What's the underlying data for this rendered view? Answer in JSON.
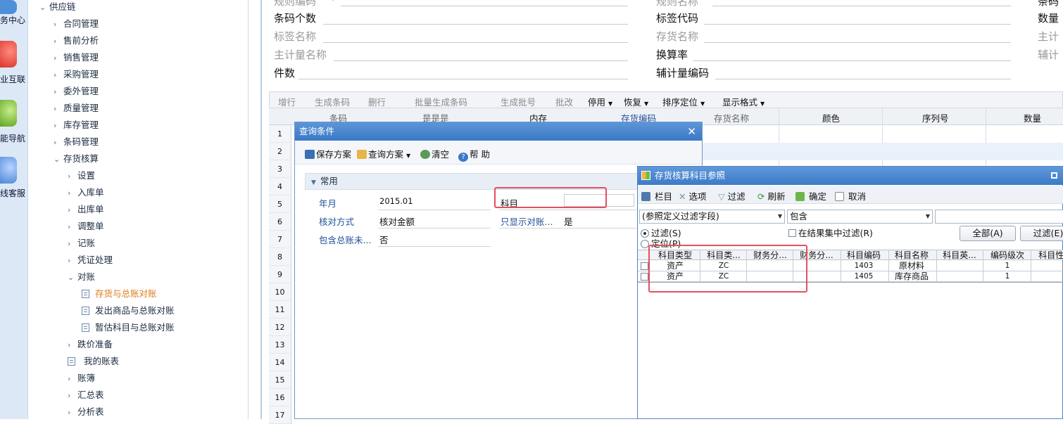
{
  "rail": {
    "items": [
      {
        "label": "服务中心",
        "icon": "service-center-icon",
        "color": "#4f8fd8"
      },
      {
        "label": "企业互联",
        "icon": "connect-icon",
        "color": "#e8483e"
      },
      {
        "label": "功能导航",
        "icon": "navigation-icon",
        "color": "#72b32c"
      },
      {
        "label": "在线客服",
        "icon": "customer-service-icon",
        "color": "#4b86d6"
      }
    ],
    "visible_labels": [
      "务中心",
      "业互联",
      "能导航",
      "线客服"
    ]
  },
  "tree": {
    "root": "供应链",
    "level1": [
      "合同管理",
      "售前分析",
      "销售管理",
      "采购管理",
      "委外管理",
      "质量管理",
      "库存管理",
      "条码管理",
      "存货核算"
    ],
    "level2": [
      "设置",
      "入库单",
      "出库单",
      "调整单",
      "记账",
      "凭证处理",
      "对账"
    ],
    "level3": [
      "存货与总账对账",
      "发出商品与总账对账",
      "暂估科目与总账对账"
    ],
    "after": [
      "跌价准备",
      "我的账表",
      "账簿",
      "汇总表",
      "分析表"
    ]
  },
  "form": {
    "col1": [
      "规则编码",
      "条码个数",
      "标签名称",
      "主计量名称",
      "件数"
    ],
    "col2": [
      "规则名称",
      "标签代码",
      "存货名称",
      "换算率",
      "辅计量编码"
    ],
    "col3": [
      "条码",
      "数量",
      "主计",
      "辅计"
    ],
    "required_mark": "*"
  },
  "grid": {
    "toolbar": [
      "增行",
      "生成条码",
      "删行",
      "批量生成条码",
      "生成批号",
      "批改",
      "停用",
      "恢复",
      "排序定位",
      "显示格式"
    ],
    "headers": [
      "条码",
      "是是是",
      "内存",
      "存货编码",
      "存货名称",
      "颜色",
      "序列号",
      "数量"
    ],
    "row_numbers": [
      "1",
      "2",
      "3",
      "4",
      "5",
      "6",
      "7",
      "8",
      "9",
      "10",
      "11",
      "12",
      "13",
      "14",
      "15",
      "16",
      "17"
    ]
  },
  "query_dialog": {
    "title": "查询条件",
    "tools": [
      "保存方案",
      "查询方案",
      "清空",
      "帮 助"
    ],
    "section": "常用",
    "fields": [
      {
        "label": "年月",
        "value": "2015.01"
      },
      {
        "label": "核对方式",
        "value": "核对金额"
      },
      {
        "label": "包含总账未...",
        "value": "否"
      }
    ],
    "right_fields": [
      {
        "label": "科目",
        "value": ""
      },
      {
        "label": "只显示对账...",
        "value": "是"
      }
    ]
  },
  "ref_dialog": {
    "title": "存货核算科目参照",
    "tools": [
      "栏目",
      "选项",
      "过滤",
      "刷新",
      "确定",
      "取消"
    ],
    "filter_field": "(参照定义过滤字段)",
    "filter_op": "包含",
    "filter_value": "",
    "radio_filter": "过滤(S)",
    "radio_locate": "定位(P)",
    "in_result": "在结果集中过滤(R)",
    "btn_all": "全部(A)",
    "btn_filter": "过滤(E)",
    "columns": [
      "科目类型",
      "科目类...",
      "财务分...",
      "财务分...",
      "科目编码",
      "科目名称",
      "科目英...",
      "编码级次",
      "科目性..."
    ],
    "rows": [
      {
        "type": "资产",
        "cat": "ZC",
        "code": "1403",
        "name": "原材料",
        "level": "1",
        "checked": true
      },
      {
        "type": "资产",
        "cat": "ZC",
        "code": "1405",
        "name": "库存商品",
        "level": "1",
        "checked": true
      }
    ]
  }
}
